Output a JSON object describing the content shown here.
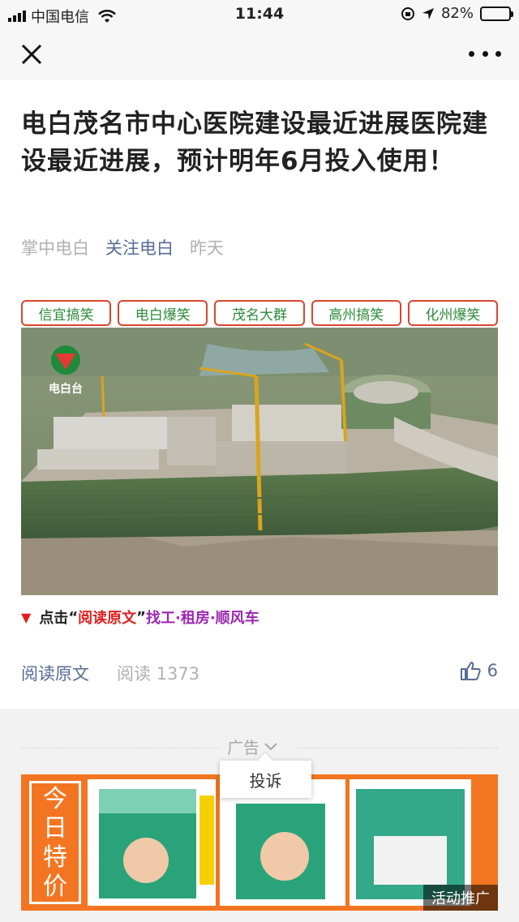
{
  "status_bar": {
    "carrier": "中国电信",
    "time": "11:44",
    "battery_percent": "82%",
    "battery_level": 0.82
  },
  "nav": {
    "close_icon": "close-icon",
    "more_icon": "more-icon"
  },
  "article": {
    "title": "电白茂名市中心医院建设最近进展医院建设最近进展，预计明年6月投入使用！",
    "source": "掌中电白",
    "account": "关注电白",
    "date": "昨天",
    "tags": [
      "信宜搞笑",
      "电白爆笑",
      "茂名大群",
      "高州搞笑",
      "化州爆笑"
    ],
    "image_logo_text": "电白台",
    "cta": {
      "prefix": "点击",
      "quote_open": "“",
      "link": "阅读原文",
      "quote_close": "”",
      "suffix": "找工·租房·顺风车"
    },
    "read_original": "阅读原文",
    "read_label": "阅读",
    "read_count": "1373",
    "like_count": "6"
  },
  "ad": {
    "label": "广告",
    "complain": "投诉",
    "banner_text": [
      "今",
      "日",
      "特",
      "价"
    ],
    "promo": "活动推广",
    "accent_color": "#f37521"
  },
  "colors": {
    "link": "#576b95",
    "tag_border": "#d9462f",
    "tag_text": "#2e8b3a",
    "cta_red": "#e02020",
    "cta_purple": "#9c27b0"
  }
}
